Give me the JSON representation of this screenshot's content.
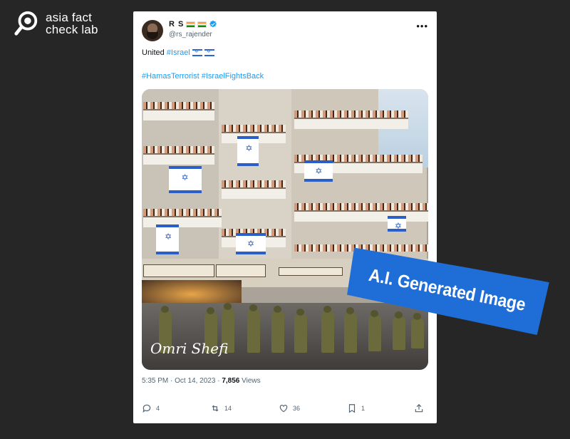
{
  "brand": {
    "line1": "asia fact",
    "line2": "check lab"
  },
  "tweet": {
    "author_name": "R S",
    "handle": "@rs_rajender",
    "text_prefix": "United",
    "hashtag_israel": "#Israel",
    "hashtag_hamas": "#HamasTerrorist",
    "hashtag_fightsback": "#IsraelFightsBack",
    "image_signature": "Omri Shefi",
    "time": "5:35 PM",
    "separator": "·",
    "date": "Oct 14, 2023",
    "views_count": "7,856",
    "views_label": "Views",
    "replies": "4",
    "reposts": "14",
    "likes": "36",
    "bookmarks": "1"
  },
  "sticker": {
    "label": "A.I. Generated Image"
  },
  "colors": {
    "link": "#1d9bf0",
    "sticker": "#1f6ed8",
    "background": "#262626"
  },
  "icons": [
    "reply-icon",
    "repost-icon",
    "like-icon",
    "bookmark-icon",
    "share-icon",
    "more-icon",
    "verified-icon"
  ]
}
